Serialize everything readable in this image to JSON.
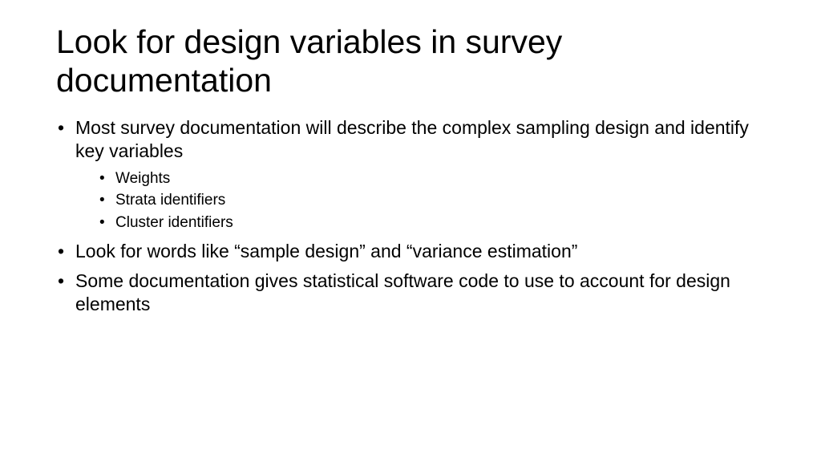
{
  "title": "Look for design variables in survey documentation",
  "bullets": [
    {
      "text": "Most survey documentation will describe the complex sampling design and identify key variables",
      "sub": [
        "Weights",
        "Strata identifiers",
        "Cluster identifiers"
      ]
    },
    {
      "text": "Look for words like “sample design” and “variance estimation”"
    },
    {
      "text": "Some documentation gives statistical software code to use to account for design elements"
    }
  ]
}
